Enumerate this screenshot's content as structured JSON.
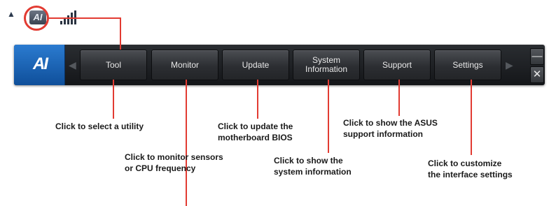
{
  "tray": {
    "expand_icon": "up-triangle-icon",
    "app_icon": "ai-suite-icon",
    "signal_icon": "signal-bars-icon"
  },
  "toolbar": {
    "logo_text": "AI",
    "buttons": [
      {
        "label": "Tool"
      },
      {
        "label": "Monitor"
      },
      {
        "label": "Update"
      },
      {
        "label": "System\nInformation"
      },
      {
        "label": "Support"
      },
      {
        "label": "Settings"
      }
    ],
    "minimize_glyph": "—",
    "close_glyph": "✕"
  },
  "captions": {
    "tool": "Click to select a utility",
    "monitor_1": "Click to monitor sensors",
    "monitor_2": "or CPU frequency",
    "update_1": "Click to update the",
    "update_2": "motherboard BIOS",
    "sysinfo_1": "Click to show the",
    "sysinfo_2": "system information",
    "support_1": "Click to show the ASUS",
    "support_2": "support information",
    "settings_1": "Click to customize",
    "settings_2": "the interface settings"
  },
  "colors": {
    "callout": "#e23b32",
    "accent": "#1d63b8"
  }
}
